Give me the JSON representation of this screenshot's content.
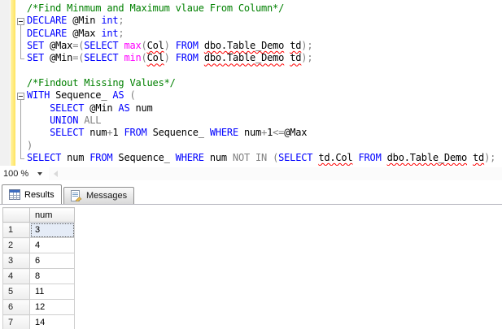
{
  "editor": {
    "syntax_colors": {
      "kw": "#0000ff",
      "cm": "#008000",
      "op": "#808080",
      "fn": "#ff00ff",
      "id": "#000000",
      "idsq": "#000000"
    },
    "error_squiggle_color": "#ff0000",
    "change_bar_color": "#ffe45e",
    "lines": [
      [
        {
          "c": "cm",
          "t": "/*Find Minmum and Maximum vlaue From Column*/"
        }
      ],
      [
        {
          "c": "kw",
          "t": "DECLARE"
        },
        {
          "c": "id",
          "t": " @Min "
        },
        {
          "c": "kw",
          "t": "int"
        },
        {
          "c": "op",
          "t": ";"
        }
      ],
      [
        {
          "c": "kw",
          "t": "DECLARE"
        },
        {
          "c": "id",
          "t": " @Max "
        },
        {
          "c": "kw",
          "t": "int"
        },
        {
          "c": "op",
          "t": ";"
        }
      ],
      [
        {
          "c": "kw",
          "t": "SET"
        },
        {
          "c": "id",
          "t": " @Max"
        },
        {
          "c": "op",
          "t": "=("
        },
        {
          "c": "kw",
          "t": "SELECT"
        },
        {
          "c": "id",
          "t": " "
        },
        {
          "c": "fn",
          "t": "max"
        },
        {
          "c": "op",
          "t": "("
        },
        {
          "c": "idsq",
          "t": "Col"
        },
        {
          "c": "op",
          "t": ") "
        },
        {
          "c": "kw",
          "t": "FROM"
        },
        {
          "c": "id",
          "t": " "
        },
        {
          "c": "idsq",
          "t": "dbo.Table_Demo"
        },
        {
          "c": "id",
          "t": " "
        },
        {
          "c": "idsq",
          "t": "td"
        },
        {
          "c": "op",
          "t": ");"
        }
      ],
      [
        {
          "c": "kw",
          "t": "SET"
        },
        {
          "c": "id",
          "t": " @Min"
        },
        {
          "c": "op",
          "t": "=("
        },
        {
          "c": "kw",
          "t": "SELECT"
        },
        {
          "c": "id",
          "t": " "
        },
        {
          "c": "fn",
          "t": "min"
        },
        {
          "c": "op",
          "t": "("
        },
        {
          "c": "idsq",
          "t": "Col"
        },
        {
          "c": "op",
          "t": ") "
        },
        {
          "c": "kw",
          "t": "FROM"
        },
        {
          "c": "id",
          "t": " "
        },
        {
          "c": "idsq",
          "t": "dbo.Table_Demo"
        },
        {
          "c": "id",
          "t": " "
        },
        {
          "c": "idsq",
          "t": "td"
        },
        {
          "c": "op",
          "t": ");"
        }
      ],
      [],
      [
        {
          "c": "cm",
          "t": "/*Findout Missing Values*/"
        }
      ],
      [
        {
          "c": "kw",
          "t": "WITH"
        },
        {
          "c": "id",
          "t": " Sequence_ "
        },
        {
          "c": "kw",
          "t": "AS"
        },
        {
          "c": "op",
          "t": " ("
        }
      ],
      [
        {
          "c": "id",
          "t": "    "
        },
        {
          "c": "kw",
          "t": "SELECT"
        },
        {
          "c": "id",
          "t": " @Min "
        },
        {
          "c": "kw",
          "t": "AS"
        },
        {
          "c": "id",
          "t": " num"
        }
      ],
      [
        {
          "c": "id",
          "t": "    "
        },
        {
          "c": "kw",
          "t": "UNION"
        },
        {
          "c": "op",
          "t": " ALL"
        }
      ],
      [
        {
          "c": "id",
          "t": "    "
        },
        {
          "c": "kw",
          "t": "SELECT"
        },
        {
          "c": "id",
          "t": " num"
        },
        {
          "c": "op",
          "t": "+"
        },
        {
          "c": "id",
          "t": "1 "
        },
        {
          "c": "kw",
          "t": "FROM"
        },
        {
          "c": "id",
          "t": " Sequence_ "
        },
        {
          "c": "kw",
          "t": "WHERE"
        },
        {
          "c": "id",
          "t": " num"
        },
        {
          "c": "op",
          "t": "+"
        },
        {
          "c": "id",
          "t": "1"
        },
        {
          "c": "op",
          "t": "<="
        },
        {
          "c": "id",
          "t": "@Max"
        }
      ],
      [
        {
          "c": "op",
          "t": ")"
        }
      ],
      [
        {
          "c": "kw",
          "t": "SELECT"
        },
        {
          "c": "id",
          "t": " num "
        },
        {
          "c": "kw",
          "t": "FROM"
        },
        {
          "c": "id",
          "t": " Sequence_ "
        },
        {
          "c": "kw",
          "t": "WHERE"
        },
        {
          "c": "id",
          "t": " num "
        },
        {
          "c": "op",
          "t": "NOT IN ("
        },
        {
          "c": "kw",
          "t": "SELECT"
        },
        {
          "c": "id",
          "t": " "
        },
        {
          "c": "idsq",
          "t": "td.Col"
        },
        {
          "c": "id",
          "t": " "
        },
        {
          "c": "kw",
          "t": "FROM"
        },
        {
          "c": "id",
          "t": " "
        },
        {
          "c": "idsq",
          "t": "dbo.Table_Demo"
        },
        {
          "c": "id",
          "t": " "
        },
        {
          "c": "idsq",
          "t": "td"
        },
        {
          "c": "op",
          "t": ");"
        }
      ]
    ]
  },
  "zoom_control": {
    "value": "100 %"
  },
  "tabs": [
    {
      "label": "Results",
      "icon": "results-grid-icon",
      "active": true
    },
    {
      "label": "Messages",
      "icon": "messages-icon",
      "active": false
    }
  ],
  "results": {
    "columns": [
      "num"
    ],
    "rows": [
      {
        "n": "1",
        "num": "3"
      },
      {
        "n": "2",
        "num": "4"
      },
      {
        "n": "3",
        "num": "6"
      },
      {
        "n": "4",
        "num": "8"
      },
      {
        "n": "5",
        "num": "11"
      },
      {
        "n": "6",
        "num": "12"
      },
      {
        "n": "7",
        "num": "14"
      }
    ],
    "selected_cell": {
      "row": 1,
      "column": "num"
    }
  }
}
